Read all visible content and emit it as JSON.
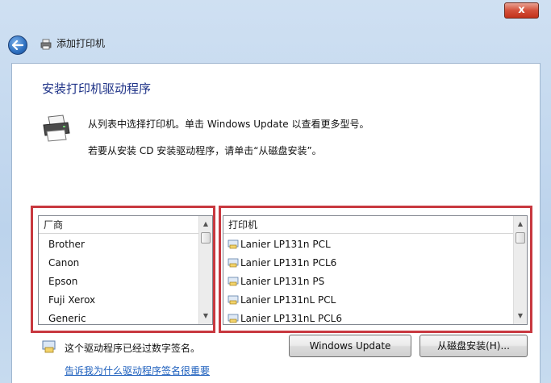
{
  "window": {
    "close_label": "x"
  },
  "nav": {
    "title": "添加打印机"
  },
  "page": {
    "heading": "安装打印机驱动程序",
    "desc_line1": "从列表中选择打印机。单击 Windows Update 以查看更多型号。",
    "desc_line2": "若要从安装 CD 安装驱动程序，请单击“从磁盘安装”。"
  },
  "manufacturers": {
    "header": "厂商",
    "items": [
      "Brother",
      "Canon",
      "Epson",
      "Fuji Xerox",
      "Generic"
    ]
  },
  "printers": {
    "header": "打印机",
    "items": [
      "Lanier LP131n PCL",
      "Lanier LP131n PCL6",
      "Lanier LP131n PS",
      "Lanier LP131nL PCL",
      "Lanier LP131nL PCL6"
    ]
  },
  "buttons": {
    "windows_update": "Windows Update",
    "have_disk": "从磁盘安装(H)..."
  },
  "signature": {
    "status": "这个驱动程序已经过数字签名。",
    "link": "告诉我为什么驱动程序签名很重要"
  },
  "colors": {
    "highlight": "#c8383f",
    "heading": "#1e3287",
    "link": "#1d5fbd"
  },
  "icons": {
    "back": "back-arrow-icon",
    "printer": "printer-icon",
    "driver": "printer-driver-icon",
    "signature": "signed-driver-icon"
  }
}
